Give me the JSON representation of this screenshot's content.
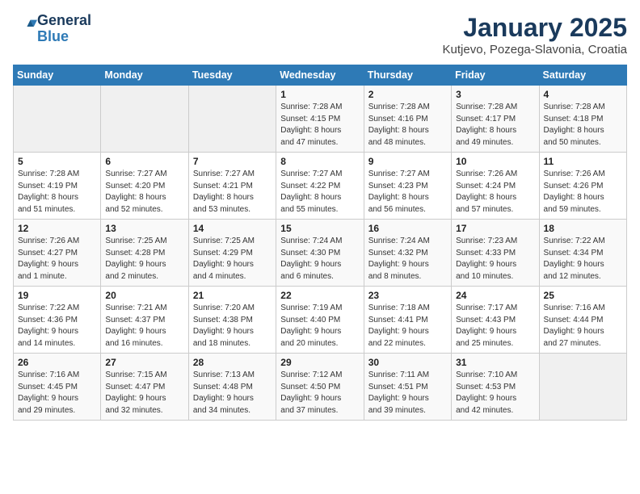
{
  "header": {
    "logo_line1": "General",
    "logo_line2": "Blue",
    "month": "January 2025",
    "location": "Kutjevo, Pozega-Slavonia, Croatia"
  },
  "weekdays": [
    "Sunday",
    "Monday",
    "Tuesday",
    "Wednesday",
    "Thursday",
    "Friday",
    "Saturday"
  ],
  "weeks": [
    [
      {
        "day": "",
        "info": ""
      },
      {
        "day": "",
        "info": ""
      },
      {
        "day": "",
        "info": ""
      },
      {
        "day": "1",
        "info": "Sunrise: 7:28 AM\nSunset: 4:15 PM\nDaylight: 8 hours\nand 47 minutes."
      },
      {
        "day": "2",
        "info": "Sunrise: 7:28 AM\nSunset: 4:16 PM\nDaylight: 8 hours\nand 48 minutes."
      },
      {
        "day": "3",
        "info": "Sunrise: 7:28 AM\nSunset: 4:17 PM\nDaylight: 8 hours\nand 49 minutes."
      },
      {
        "day": "4",
        "info": "Sunrise: 7:28 AM\nSunset: 4:18 PM\nDaylight: 8 hours\nand 50 minutes."
      }
    ],
    [
      {
        "day": "5",
        "info": "Sunrise: 7:28 AM\nSunset: 4:19 PM\nDaylight: 8 hours\nand 51 minutes."
      },
      {
        "day": "6",
        "info": "Sunrise: 7:27 AM\nSunset: 4:20 PM\nDaylight: 8 hours\nand 52 minutes."
      },
      {
        "day": "7",
        "info": "Sunrise: 7:27 AM\nSunset: 4:21 PM\nDaylight: 8 hours\nand 53 minutes."
      },
      {
        "day": "8",
        "info": "Sunrise: 7:27 AM\nSunset: 4:22 PM\nDaylight: 8 hours\nand 55 minutes."
      },
      {
        "day": "9",
        "info": "Sunrise: 7:27 AM\nSunset: 4:23 PM\nDaylight: 8 hours\nand 56 minutes."
      },
      {
        "day": "10",
        "info": "Sunrise: 7:26 AM\nSunset: 4:24 PM\nDaylight: 8 hours\nand 57 minutes."
      },
      {
        "day": "11",
        "info": "Sunrise: 7:26 AM\nSunset: 4:26 PM\nDaylight: 8 hours\nand 59 minutes."
      }
    ],
    [
      {
        "day": "12",
        "info": "Sunrise: 7:26 AM\nSunset: 4:27 PM\nDaylight: 9 hours\nand 1 minute."
      },
      {
        "day": "13",
        "info": "Sunrise: 7:25 AM\nSunset: 4:28 PM\nDaylight: 9 hours\nand 2 minutes."
      },
      {
        "day": "14",
        "info": "Sunrise: 7:25 AM\nSunset: 4:29 PM\nDaylight: 9 hours\nand 4 minutes."
      },
      {
        "day": "15",
        "info": "Sunrise: 7:24 AM\nSunset: 4:30 PM\nDaylight: 9 hours\nand 6 minutes."
      },
      {
        "day": "16",
        "info": "Sunrise: 7:24 AM\nSunset: 4:32 PM\nDaylight: 9 hours\nand 8 minutes."
      },
      {
        "day": "17",
        "info": "Sunrise: 7:23 AM\nSunset: 4:33 PM\nDaylight: 9 hours\nand 10 minutes."
      },
      {
        "day": "18",
        "info": "Sunrise: 7:22 AM\nSunset: 4:34 PM\nDaylight: 9 hours\nand 12 minutes."
      }
    ],
    [
      {
        "day": "19",
        "info": "Sunrise: 7:22 AM\nSunset: 4:36 PM\nDaylight: 9 hours\nand 14 minutes."
      },
      {
        "day": "20",
        "info": "Sunrise: 7:21 AM\nSunset: 4:37 PM\nDaylight: 9 hours\nand 16 minutes."
      },
      {
        "day": "21",
        "info": "Sunrise: 7:20 AM\nSunset: 4:38 PM\nDaylight: 9 hours\nand 18 minutes."
      },
      {
        "day": "22",
        "info": "Sunrise: 7:19 AM\nSunset: 4:40 PM\nDaylight: 9 hours\nand 20 minutes."
      },
      {
        "day": "23",
        "info": "Sunrise: 7:18 AM\nSunset: 4:41 PM\nDaylight: 9 hours\nand 22 minutes."
      },
      {
        "day": "24",
        "info": "Sunrise: 7:17 AM\nSunset: 4:43 PM\nDaylight: 9 hours\nand 25 minutes."
      },
      {
        "day": "25",
        "info": "Sunrise: 7:16 AM\nSunset: 4:44 PM\nDaylight: 9 hours\nand 27 minutes."
      }
    ],
    [
      {
        "day": "26",
        "info": "Sunrise: 7:16 AM\nSunset: 4:45 PM\nDaylight: 9 hours\nand 29 minutes."
      },
      {
        "day": "27",
        "info": "Sunrise: 7:15 AM\nSunset: 4:47 PM\nDaylight: 9 hours\nand 32 minutes."
      },
      {
        "day": "28",
        "info": "Sunrise: 7:13 AM\nSunset: 4:48 PM\nDaylight: 9 hours\nand 34 minutes."
      },
      {
        "day": "29",
        "info": "Sunrise: 7:12 AM\nSunset: 4:50 PM\nDaylight: 9 hours\nand 37 minutes."
      },
      {
        "day": "30",
        "info": "Sunrise: 7:11 AM\nSunset: 4:51 PM\nDaylight: 9 hours\nand 39 minutes."
      },
      {
        "day": "31",
        "info": "Sunrise: 7:10 AM\nSunset: 4:53 PM\nDaylight: 9 hours\nand 42 minutes."
      },
      {
        "day": "",
        "info": ""
      }
    ]
  ]
}
